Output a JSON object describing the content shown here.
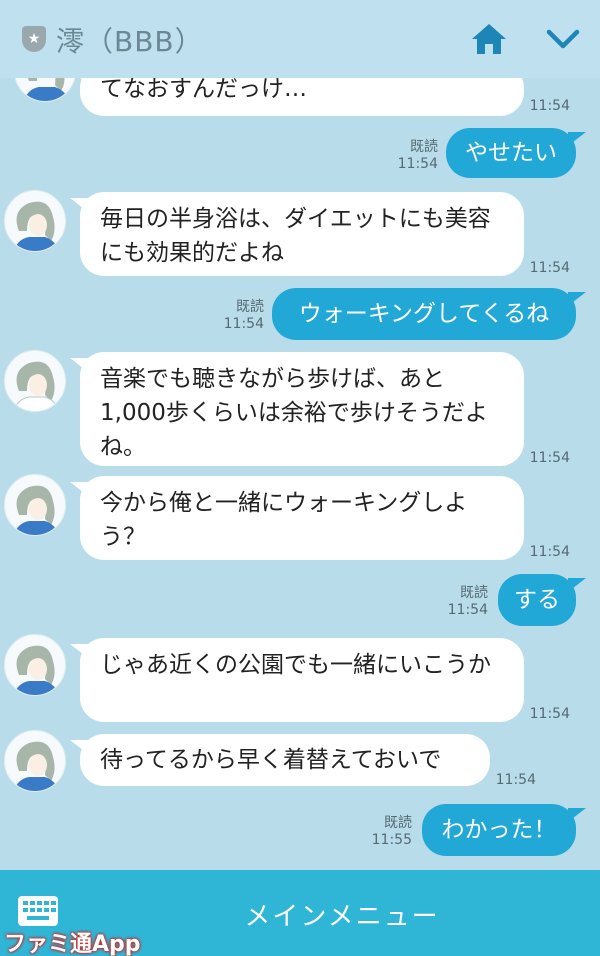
{
  "header": {
    "title": "澪（BBB）"
  },
  "messages": [
    {
      "side": "left",
      "text": "てなおすんだっけ…",
      "time": "11:54"
    },
    {
      "side": "right",
      "text": "やせたい",
      "read": "既読",
      "time": "11:54"
    },
    {
      "side": "left",
      "text": "毎日の半身浴は、ダイエットにも美容にも効果的だよね",
      "time": "11:54"
    },
    {
      "side": "right",
      "text": "ウォーキングしてくるね",
      "read": "既読",
      "time": "11:54"
    },
    {
      "side": "left",
      "text": "音楽でも聴きながら歩けば、あと1,000歩くらいは余裕で歩けそうだよね。",
      "time": "11:54"
    },
    {
      "side": "left",
      "text": "今から俺と一緒にウォーキングしよう？",
      "time": "11:54"
    },
    {
      "side": "right",
      "text": "する",
      "read": "既読",
      "time": "11:54"
    },
    {
      "side": "left",
      "text": "じゃあ近くの公園でも一緒にいこうか",
      "time": "11:54"
    },
    {
      "side": "left",
      "text": "待ってるから早く着替えておいで",
      "time": "11:54"
    },
    {
      "side": "right",
      "text": "わかった！",
      "read": "既読",
      "time": "11:55"
    }
  ],
  "footer": {
    "menu_label": "メインメニュー"
  },
  "watermark": "ファミ通App",
  "colors": {
    "background": "#b9dcea",
    "own_bubble": "#22a8d6",
    "footer": "#2fb6d7"
  }
}
